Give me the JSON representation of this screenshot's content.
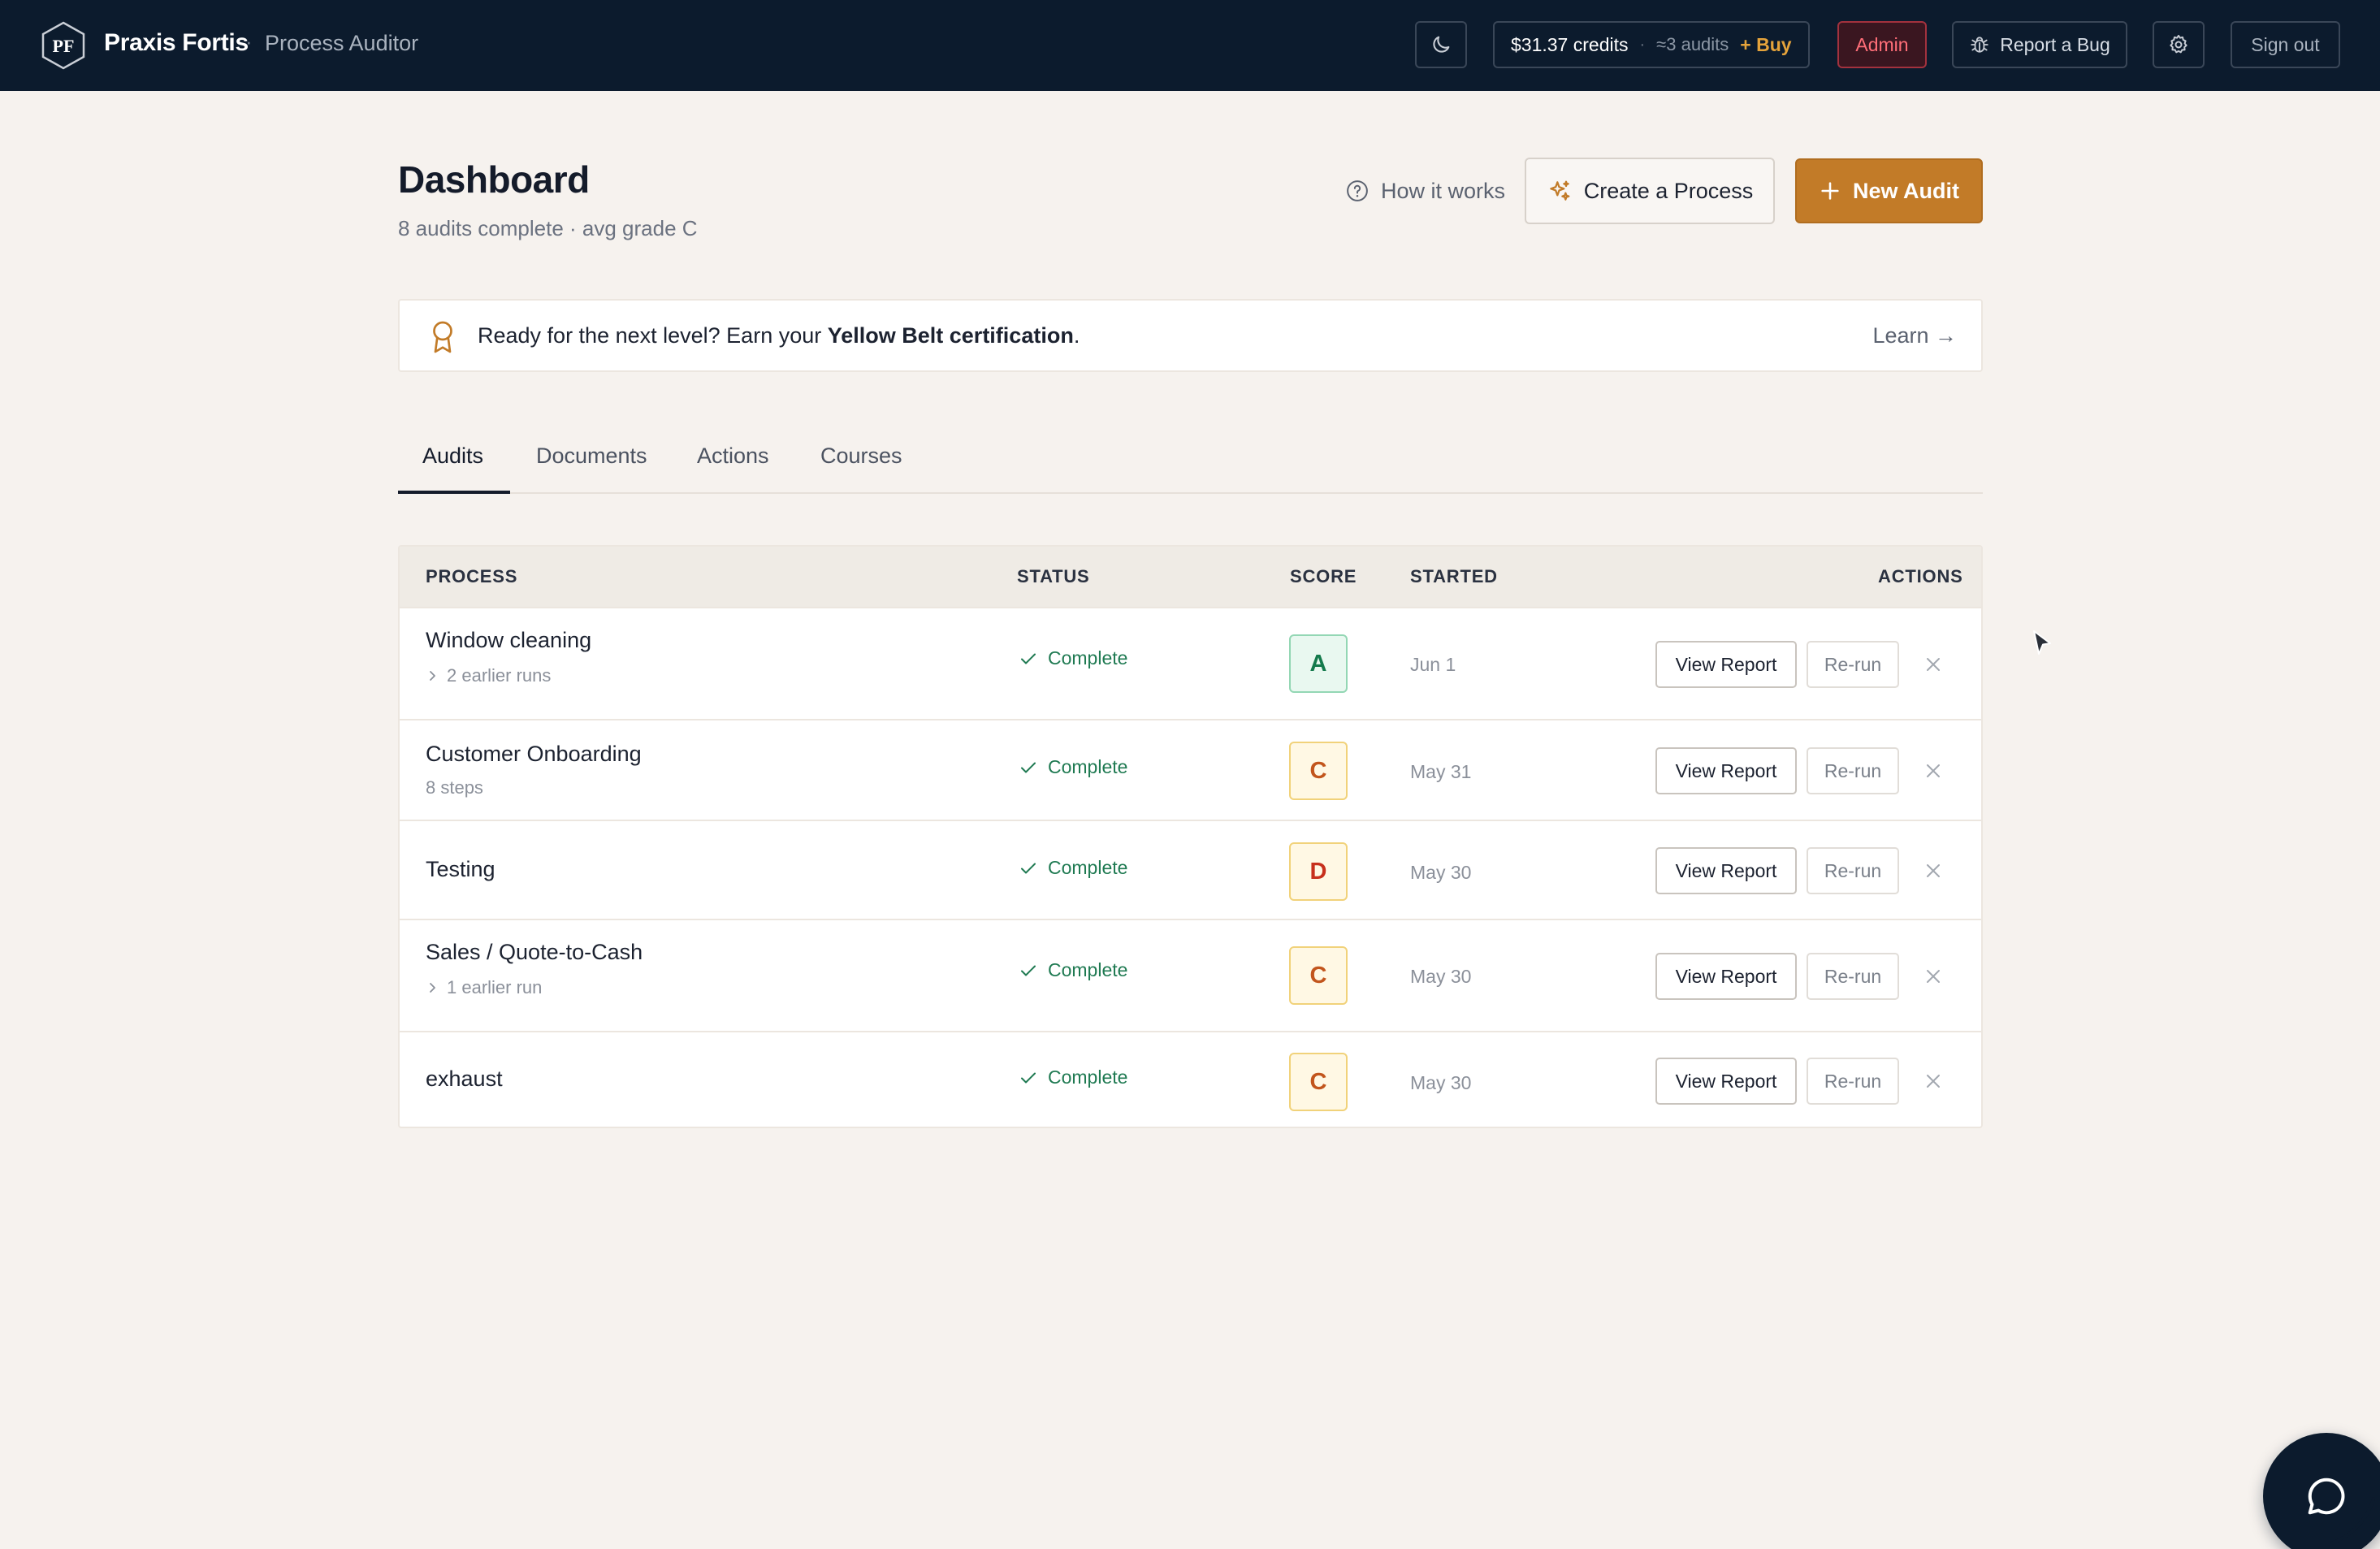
{
  "topbar": {
    "logo_text": "PF",
    "brand": "Praxis Fortis",
    "separator": "·",
    "subtitle": "Process Auditor",
    "theme_icon": "moon-icon",
    "credits": {
      "amount": "$31.37 credits",
      "separator": "·",
      "audits": "≈3 audits",
      "buy": "+ Buy"
    },
    "admin": "Admin",
    "report_bug": "Report a Bug",
    "settings_icon": "gear-icon",
    "sign_out": "Sign out"
  },
  "header": {
    "title": "Dashboard",
    "subtitle": "8 audits complete · avg grade C",
    "how_it_works": "How it works",
    "create_process": "Create a Process",
    "new_audit": "New Audit"
  },
  "banner": {
    "prefix": "Ready for the next level? Earn your ",
    "highlight": "Yellow Belt certification",
    "suffix": ".",
    "learn": "Learn →"
  },
  "tabs": [
    {
      "label": "Audits",
      "active": true
    },
    {
      "label": "Documents",
      "active": false
    },
    {
      "label": "Actions",
      "active": false
    },
    {
      "label": "Courses",
      "active": false
    }
  ],
  "table": {
    "columns": {
      "process": "PROCESS",
      "status": "STATUS",
      "score": "SCORE",
      "started": "STARTED",
      "actions": "ACTIONS"
    },
    "view_label": "View Report",
    "rerun_label": "Re-run",
    "rows": [
      {
        "name": "Window cleaning",
        "sub": "2 earlier runs",
        "status": "Complete",
        "grade": "A",
        "started": "Jun 1"
      },
      {
        "name": "Customer Onboarding",
        "sub": "8 steps",
        "status": "Complete",
        "grade": "C",
        "started": "May 31"
      },
      {
        "name": "Testing",
        "sub": "",
        "status": "Complete",
        "grade": "D",
        "started": "May 30"
      },
      {
        "name": "Sales / Quote-to-Cash",
        "sub": "1 earlier run",
        "status": "Complete",
        "grade": "C",
        "started": "May 30"
      },
      {
        "name": "exhaust",
        "sub": "",
        "status": "Complete",
        "grade": "C",
        "started": "May 30"
      }
    ]
  },
  "colors": {
    "navbar": "#0c1b2d",
    "accent": "#c27b28",
    "success": "#1f7a52",
    "danger": "#ff6e78",
    "background": "#f6f2ee"
  }
}
